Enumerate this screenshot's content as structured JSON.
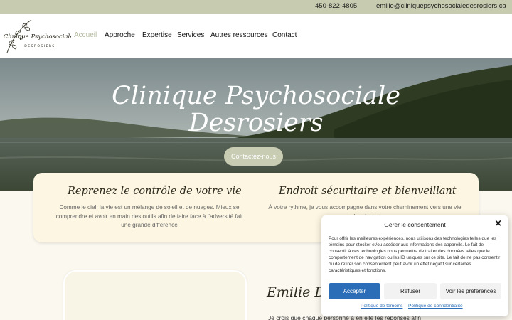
{
  "topbar": {
    "phone": "450-822-4805",
    "email": "emilie@cliniquepsychosocialedesrosiers.ca"
  },
  "logo": {
    "line1": "Clinique Psychosociale",
    "line2": "DESROSIERS"
  },
  "nav": {
    "items": [
      {
        "label": "Accueil",
        "active": true
      },
      {
        "label": "Approche",
        "active": false
      },
      {
        "label": "Expertise",
        "active": false
      },
      {
        "label": "Services",
        "active": false
      },
      {
        "label": "Autres ressources",
        "active": false
      },
      {
        "label": "Contact",
        "active": false
      }
    ]
  },
  "hero": {
    "title_line1": "Clinique Psychosociale",
    "title_line2": "Desrosiers",
    "cta": "Contactez-nous"
  },
  "features": [
    {
      "title": "Reprenez le contrôle de votre vie",
      "text": "Comme le ciel, la vie est un mélange de soleil et de nuages. Mieux se comprendre et avoir en main des outils afin de faire face à l'adversité fait une grande différence"
    },
    {
      "title": "Endroit sécuritaire et bienveillant",
      "text": "À votre rythme, je vous accompagne dans votre cheminement vers une vie plus douce"
    }
  ],
  "about": {
    "name": "Emilie D",
    "text": "Je crois que chaque personne a en elle les réponses afin"
  },
  "consent": {
    "title": "Gérer le consentement",
    "close_icon": "×",
    "body": "Pour offrir les meilleures expériences, nous utilisons des technologies telles que les témoins pour stocker et/ou accéder aux informations des appareils. Le fait de consentir à ces technologies nous permettra de traiter des données telles que le comportement de navigation ou les ID uniques sur ce site. Le fait de ne pas consentir ou de retirer son consentement peut avoir un effet négatif sur certaines caractéristiques et fonctions.",
    "accept": "Accepter",
    "refuse": "Refuser",
    "preferences": "Voir les préférences",
    "link_cookies": "Politique de témoins",
    "link_privacy": "Politique de confidentialité"
  },
  "colors": {
    "topbar": "#c7cbb0",
    "nav_active": "#b3ba9c",
    "button_sage": "#c8ccb2",
    "card_bg": "#fcf6e2",
    "accept_blue": "#2b6db6"
  }
}
